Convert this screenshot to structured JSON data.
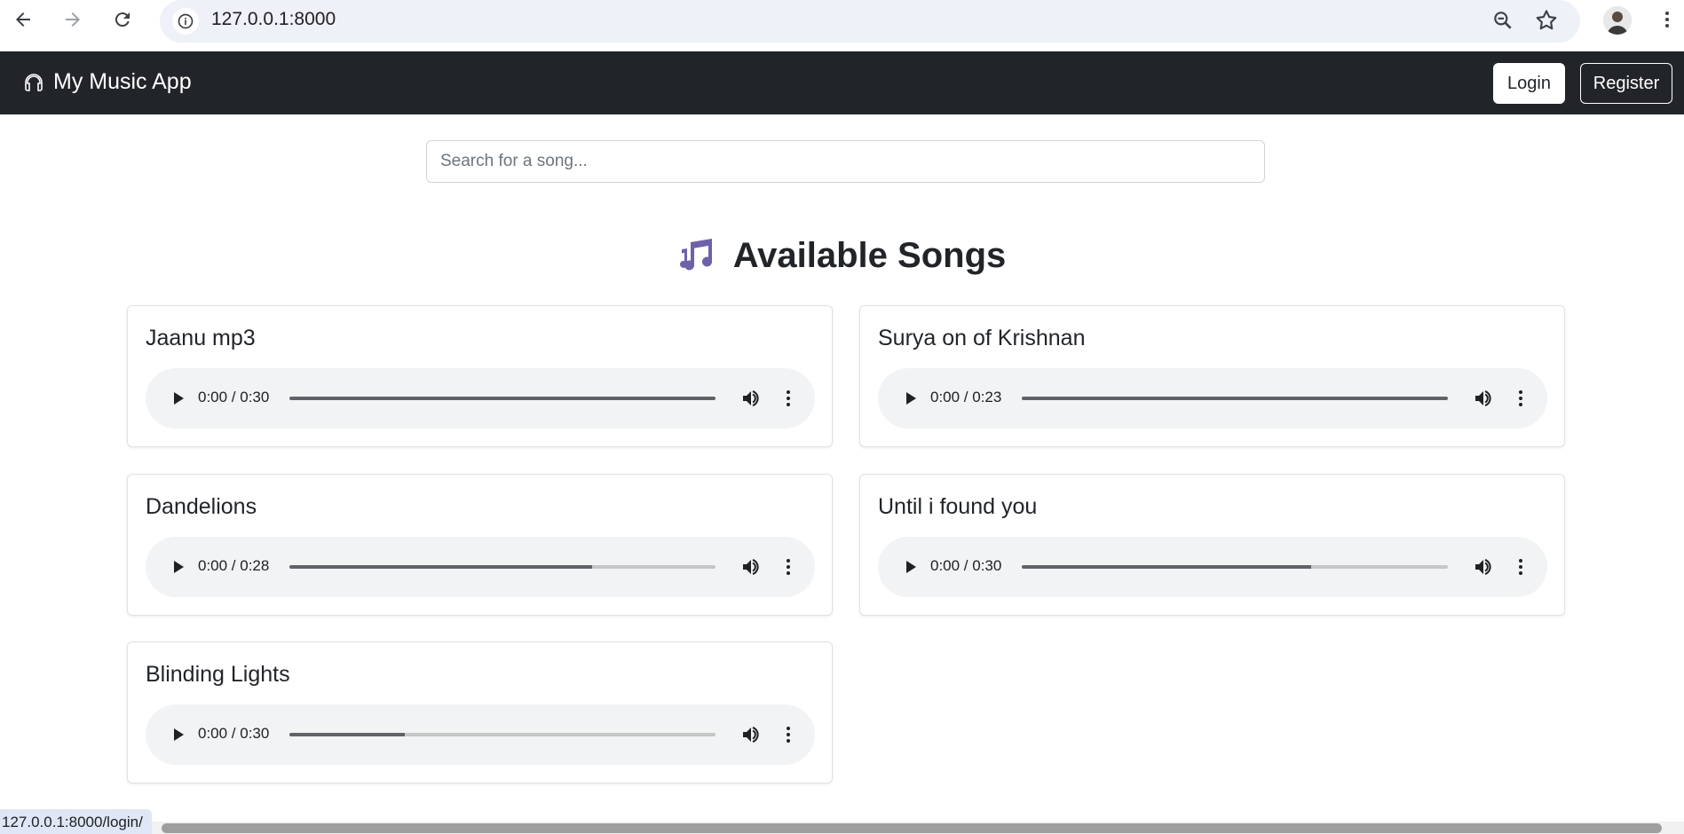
{
  "browser": {
    "url": "127.0.0.1:8000",
    "status_url": "127.0.0.1:8000/login/"
  },
  "navbar": {
    "brand": "My Music App",
    "brand_icon": "headphones-icon",
    "login_label": "Login",
    "register_label": "Register"
  },
  "search": {
    "placeholder": "Search for a song...",
    "value": ""
  },
  "heading": {
    "title": "Available Songs",
    "icon": "music-notes-icon",
    "icon_color": "#6f61a8"
  },
  "songs": [
    {
      "title": "Jaanu mp3",
      "time": "0:00 / 0:30",
      "progress": 1.0
    },
    {
      "title": "Surya on of Krishnan",
      "time": "0:00 / 0:23",
      "progress": 1.0
    },
    {
      "title": "Dandelions",
      "time": "0:00 / 0:28",
      "progress": 0.71
    },
    {
      "title": "Until i found you",
      "time": "0:00 / 0:30",
      "progress": 0.68
    },
    {
      "title": "Blinding Lights",
      "time": "0:00 / 0:30",
      "progress": 0.27
    }
  ]
}
